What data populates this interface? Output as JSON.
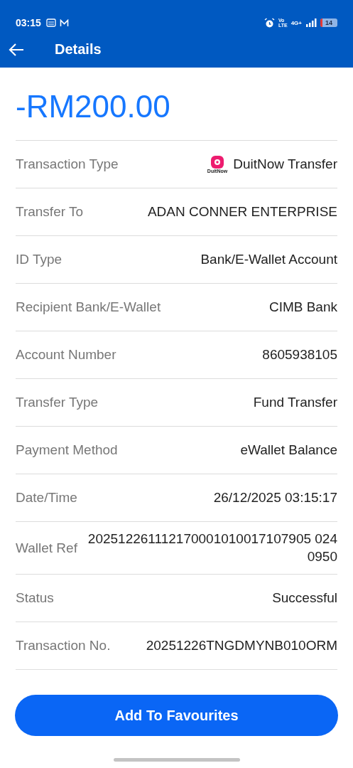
{
  "status_bar": {
    "time": "03:15",
    "volte_top": "Vo",
    "volte_bottom": "LTE",
    "network": "4G+",
    "battery": "14"
  },
  "header": {
    "title": "Details"
  },
  "amount": "-RM200.00",
  "rows": [
    {
      "label": "Transaction Type",
      "value": "DuitNow Transfer",
      "logo_text": "DuitNow"
    },
    {
      "label": "Transfer To",
      "value": "ADAN CONNER ENTERPRISE"
    },
    {
      "label": "ID Type",
      "value": "Bank/E-Wallet Account"
    },
    {
      "label": "Recipient Bank/E-Wallet",
      "value": "CIMB Bank"
    },
    {
      "label": "Account Number",
      "value": "8605938105"
    },
    {
      "label": "Transfer Type",
      "value": "Fund Transfer"
    },
    {
      "label": "Payment Method",
      "value": "eWallet Balance"
    },
    {
      "label": "Date/Time",
      "value": "26/12/2025 03:15:17"
    },
    {
      "label": "Wallet Ref",
      "value": "202512261112170001010017107905 0240950"
    },
    {
      "label": "Status",
      "value": "Successful"
    },
    {
      "label": "Transaction No.",
      "value": "20251226TNGDMYNB010ORM"
    }
  ],
  "button": "Add To Favourites"
}
